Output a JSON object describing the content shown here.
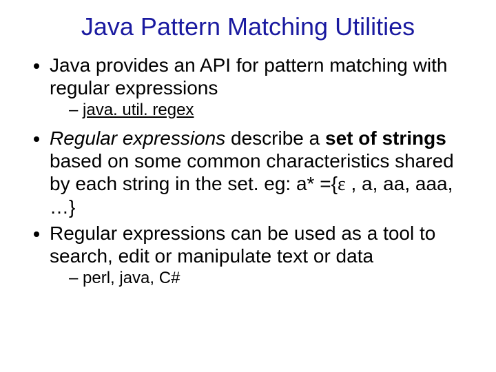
{
  "title": "Java Pattern Matching Utilities",
  "bullets": {
    "b1": "Java provides an API for pattern matching with regular expressions",
    "b1_sub": "java. util. regex",
    "b2_italic": "Regular expressions",
    "b2_mid": " describe a ",
    "b2_bold": "set of strings",
    "b2_rest_a": " based on some common characteristics shared by each string in the set. eg:  a* ={",
    "b2_eps": "ɛ",
    "b2_rest_b": " , a, aa, aaa, …}",
    "b3": "Regular expressions can be used as a tool to search, edit or manipulate text or data",
    "b3_sub": "perl, java, C#"
  }
}
